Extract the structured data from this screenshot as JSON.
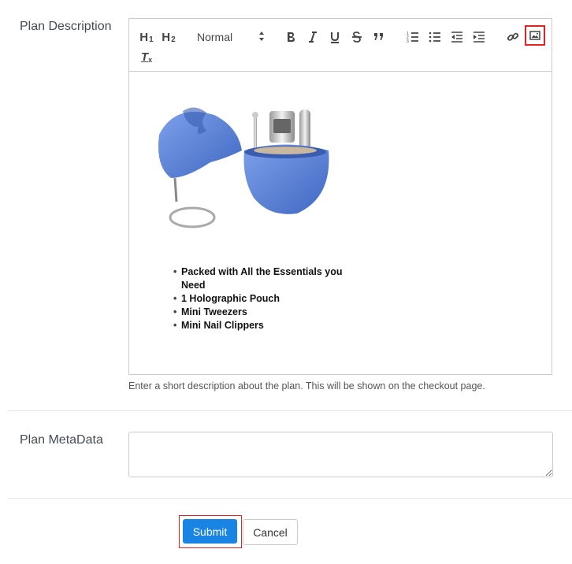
{
  "plan_description": {
    "label": "Plan Description",
    "help_text": "Enter a short description about the plan. This will be shown on the checkout page."
  },
  "toolbar": {
    "h1_label": "H",
    "h1_sub": "1",
    "h2_label": "H",
    "h2_sub": "2",
    "size_select": "Normal",
    "tx_label": "T"
  },
  "editor_content": {
    "bullets": [
      "Packed with All the Essentials you Need",
      "1 Holographic Pouch",
      "Mini Tweezers",
      "Mini Nail Clippers"
    ]
  },
  "plan_metadata": {
    "label": "Plan MetaData",
    "value": ""
  },
  "actions": {
    "submit_label": "Submit",
    "cancel_label": "Cancel"
  },
  "colors": {
    "accent": "#1a84e5",
    "highlight": "#e02424",
    "product_blue": "#5b82d6"
  }
}
